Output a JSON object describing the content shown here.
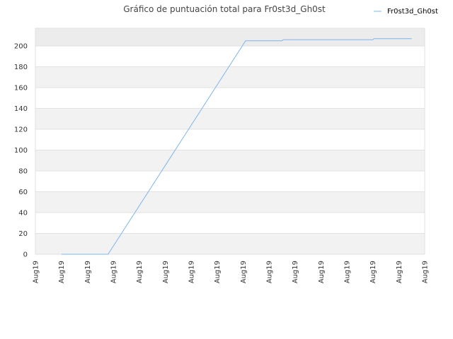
{
  "chart_data": {
    "type": "line",
    "title": "Gráfico de puntuación total para Fr0st3d_Gh0st",
    "xlabel": "",
    "ylabel": "",
    "x_tick_labels": [
      "Aug19",
      "Aug19",
      "Aug19",
      "Aug19",
      "Aug19",
      "Aug19",
      "Aug19",
      "Aug19",
      "Aug19",
      "Aug19",
      "Aug19",
      "Aug19",
      "Aug19",
      "Aug19",
      "Aug19",
      "Aug19"
    ],
    "ylim": [
      0,
      217
    ],
    "y_ticks": [
      0,
      20,
      40,
      60,
      80,
      100,
      120,
      140,
      160,
      180,
      200
    ],
    "grid": true,
    "legend_position": "top-right",
    "series": [
      {
        "name": "Fr0st3d_Gh0st",
        "color": "#7cb5ec",
        "x_index": [
          1,
          2.8,
          8.1,
          9.5,
          9.55,
          13.0,
          13.05,
          14.5
        ],
        "y": [
          0,
          0,
          205,
          205,
          206,
          206,
          207,
          207
        ]
      }
    ]
  }
}
